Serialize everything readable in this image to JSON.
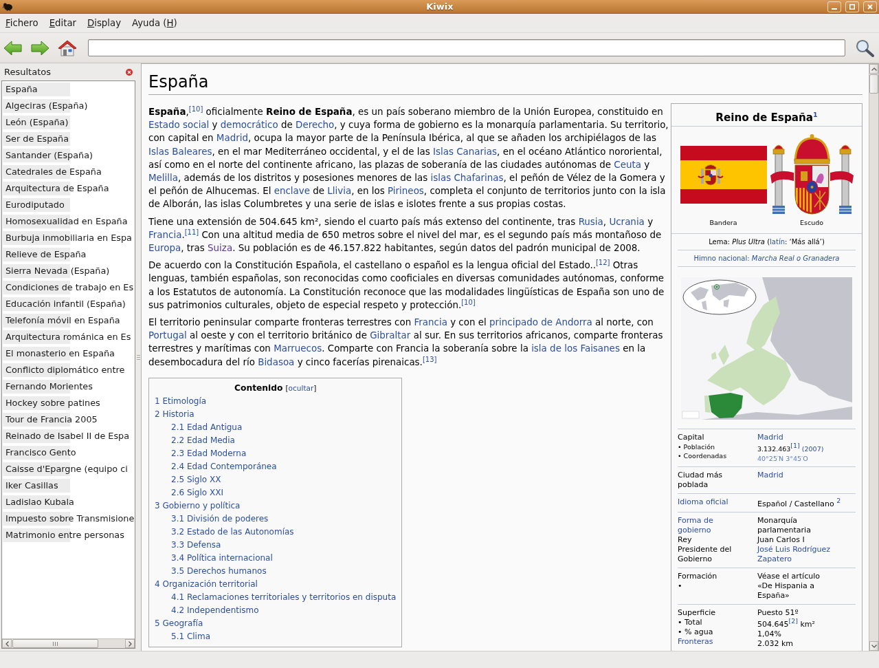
{
  "window": {
    "title": "Kiwix"
  },
  "menu": [
    {
      "key": "F",
      "after": "ichero"
    },
    {
      "key": "E",
      "after": "ditar"
    },
    {
      "key": "D",
      "after": "isplay"
    },
    {
      "before": "Ayuda (",
      "key": "H",
      "after": ")"
    }
  ],
  "sidebar": {
    "title": "Resultatos",
    "items": [
      "España",
      "Algeciras (España)",
      "León (España)",
      "Ser de España",
      "Santander (España)",
      "Catedrales de España",
      "Arquitectura de España",
      "Eurodiputado",
      "Homosexualidad en España",
      "Burbuja inmobiliaria en Espa",
      "Relieve de España",
      "Sierra Nevada (España)",
      "Condiciones de trabajo en Es",
      "Educación infantil (España)",
      "Telefonía móvil en España",
      "Arquitectura románica en Es",
      "El monasterio en España",
      "Conflicto diplomático entre",
      "Fernando Morientes",
      "Hockey sobre patines",
      "Tour de Francia 2005",
      "Reinado de Isabel II de Espa",
      "Francisco Gento",
      "Caisse d'Epargne (equipo ci",
      "Iker Casillas",
      "Ladislao Kubala",
      "Impuesto sobre Transmisione",
      "Matrimonio entre personas"
    ]
  },
  "article": {
    "title": "España",
    "paragraphs": [
      [
        {
          "kind": "text",
          "text": "**España**,"
        },
        {
          "kind": "ref",
          "text": "[10]"
        },
        {
          "kind": "text",
          "text": " oficialmente **Reino de España**, es un país soberano miembro de la Unión Europea, constituido en "
        },
        {
          "kind": "link",
          "text": "Estado social"
        },
        {
          "kind": "text",
          "text": " y "
        },
        {
          "kind": "link",
          "text": "democrático"
        },
        {
          "kind": "text",
          "text": " de "
        },
        {
          "kind": "link",
          "text": "Derecho"
        },
        {
          "kind": "text",
          "text": ", y cuya forma de gobierno es la monarquía parlamentaria. Su territorio, con capital en "
        },
        {
          "kind": "link",
          "text": "Madrid"
        },
        {
          "kind": "text",
          "text": ", ocupa la mayor parte de la Península Ibérica, al que se añaden los archipiélagos de las "
        },
        {
          "kind": "link",
          "text": "Islas"
        },
        {
          "kind": "link",
          "text": "Baleares"
        },
        {
          "kind": "text",
          "text": ", en el mar Mediterráneo occidental, y el de las "
        },
        {
          "kind": "link",
          "text": "Islas Canarias"
        },
        {
          "kind": "text",
          "text": ", en el océano Atlántico nororiental, así como en el norte del continente africano, las plazas de soberanía de las ciudades autónomas de "
        },
        {
          "kind": "link",
          "text": "Ceuta"
        },
        {
          "kind": "text",
          "text": " y "
        },
        {
          "kind": "link",
          "text": "Melilla"
        },
        {
          "kind": "text",
          "text": ", además de los distritos y posesiones menores de las "
        },
        {
          "kind": "link",
          "text": "islas Chafarinas"
        },
        {
          "kind": "text",
          "text": ", el peñón de Vélez de la Gomera y el peñón de Alhucemas. El "
        },
        {
          "kind": "link",
          "text": "enclave"
        },
        {
          "kind": "text",
          "text": " de "
        },
        {
          "kind": "link",
          "text": "Llivia"
        },
        {
          "kind": "text",
          "text": ", en los "
        },
        {
          "kind": "link",
          "text": "Pirineos"
        },
        {
          "kind": "text",
          "text": ", completa el conjunto de territorios junto con la isla de Alborán, las islas Columbretes y una serie de islas e islotes frente a sus propias costas."
        }
      ],
      [
        {
          "kind": "text",
          "text": "Tiene una extensión de 504.645 km², siendo el cuarto país más extenso del continente, tras "
        },
        {
          "kind": "link",
          "text": "Rusia"
        },
        {
          "kind": "text",
          "text": ", "
        },
        {
          "kind": "link",
          "text": "Ucrania"
        },
        {
          "kind": "text",
          "text": " y "
        },
        {
          "kind": "link",
          "text": "Francia"
        },
        {
          "kind": "text",
          "text": "."
        },
        {
          "kind": "ref",
          "text": "[11]"
        },
        {
          "kind": "text",
          "text": " Con una altitud media de 650 metros sobre el nivel del mar, es el segundo país más montañoso de "
        },
        {
          "kind": "link",
          "text": "Europa"
        },
        {
          "kind": "text",
          "text": ", tras "
        },
        {
          "kind": "visited",
          "text": "Suiza"
        },
        {
          "kind": "text",
          "text": ". Su población es de 46.157.822 habitantes, según datos del padrón municipal de 2008."
        }
      ],
      [
        {
          "kind": "text",
          "text": "De acuerdo con la Constitución Española, el castellano o español es la lengua oficial del Estado.."
        },
        {
          "kind": "ref",
          "text": "[12]"
        },
        {
          "kind": "text",
          "text": " Otras lenguas, también españolas, son reconocidas como cooficiales en diversas comunidades autónomas, conforme a los Estatutos de autonomía. La Constitución reconoce que las modalidades lingüísticas de España son uno de sus patrimonios culturales, objeto de especial respeto y protección."
        },
        {
          "kind": "ref",
          "text": "[10]"
        }
      ],
      [
        {
          "kind": "text",
          "text": "El territorio peninsular comparte fronteras terrestres con "
        },
        {
          "kind": "link",
          "text": "Francia"
        },
        {
          "kind": "text",
          "text": " y con el "
        },
        {
          "kind": "link",
          "text": "principado de Andorra"
        },
        {
          "kind": "text",
          "text": " al norte, con "
        },
        {
          "kind": "link",
          "text": "Portugal"
        },
        {
          "kind": "text",
          "text": " al oeste y con el territorio británico de "
        },
        {
          "kind": "link",
          "text": "Gibraltar"
        },
        {
          "kind": "text",
          "text": " al sur. En sus territorios africanos, comparte fronteras terrestres y marítimas con "
        },
        {
          "kind": "link",
          "text": "Marruecos"
        },
        {
          "kind": "text",
          "text": ". Comparte con Francia la soberanía sobre la "
        },
        {
          "kind": "link",
          "text": "isla de los Faisanes"
        },
        {
          "kind": "text",
          "text": " en la desembocadura del río "
        },
        {
          "kind": "link",
          "text": "Bidasoa"
        },
        {
          "kind": "text",
          "text": " y cinco facerías pirenaicas."
        },
        {
          "kind": "ref",
          "text": "[13]"
        }
      ]
    ],
    "toc": {
      "title": "Contenido",
      "toggle": {
        "before": "[",
        "link": "ocultar",
        "after": "]"
      },
      "items": [
        {
          "label": "1 Etimología"
        },
        {
          "label": "2 Historia",
          "children": [
            {
              "label": "2.1 Edad Antigua"
            },
            {
              "label": "2.2 Edad Media"
            },
            {
              "label": "2.3 Edad Moderna"
            },
            {
              "label": "2.4 Edad Contemporánea"
            },
            {
              "label": "2.5 Siglo XX"
            },
            {
              "label": "2.6 Siglo XXI"
            }
          ]
        },
        {
          "label": "3 Gobierno y política",
          "children": [
            {
              "label": "3.1 División de poderes"
            },
            {
              "label": "3.2 Estado de las Autonomías"
            },
            {
              "label": "3.3 Defensa"
            },
            {
              "label": "3.4 Política internacional"
            },
            {
              "label": "3.5 Derechos humanos"
            }
          ]
        },
        {
          "label": "4 Organización territorial",
          "children": [
            {
              "label": "4.1 Reclamaciones territoriales y territorios en disputa"
            },
            {
              "label": "4.2 Independentismo"
            }
          ]
        },
        {
          "label": "5 Geografía",
          "children": [
            {
              "label": "5.1 Clima"
            }
          ]
        }
      ]
    }
  },
  "infobox": {
    "title": "Reino de España",
    "title_ref": "1",
    "images": [
      {
        "kind": "flag",
        "caption": "Bandera"
      },
      {
        "kind": "coat_of_arms",
        "caption": "Escudo"
      }
    ],
    "motto": [
      {
        "kind": "text",
        "text": "Lema: *Plus Ultra* ("
      },
      {
        "kind": "link",
        "text": "latín"
      },
      {
        "kind": "text",
        "text": ": ‘Más allá’)"
      }
    ],
    "anthem": "Himno nacional: *Marcha Real o Granadera*",
    "rows": [
      {
        "labels": [
          [
            {
              "kind": "text",
              "text": "Capital"
            }
          ],
          [
            {
              "kind": "small",
              "text": "• Población"
            }
          ],
          [
            {
              "kind": "small",
              "text": "• Coordenadas"
            }
          ]
        ],
        "values": [
          [
            {
              "kind": "link",
              "text": "Madrid"
            }
          ],
          [
            {
              "kind": "small",
              "text": "3.132.463"
            },
            {
              "kind": "ref",
              "text": "[1]"
            },
            {
              "kind": "small_link",
              "text": "(2007)"
            }
          ],
          [
            {
              "kind": "coord",
              "text": "40°25′N 3°45′O"
            }
          ]
        ]
      },
      {
        "labels": [
          [
            {
              "kind": "text",
              "text": "Ciudad más poblada"
            }
          ]
        ],
        "values": [
          [
            {
              "kind": "link",
              "text": "Madrid"
            }
          ]
        ]
      },
      {
        "labels": [
          [
            {
              "kind": "link",
              "text": "Idioma oficial"
            }
          ]
        ],
        "values": [
          [
            {
              "kind": "text",
              "text": "Español / Castellano "
            },
            {
              "kind": "ref",
              "text": "2"
            }
          ]
        ]
      },
      {
        "labels": [
          [
            {
              "kind": "link",
              "text": "Forma de gobierno"
            }
          ],
          [
            {
              "kind": "text",
              "text": "Rey"
            }
          ],
          [
            {
              "kind": "text",
              "text": "Presidente del Gobierno"
            }
          ]
        ],
        "values": [
          [
            {
              "kind": "text",
              "text": "Monarquía parlamentaria"
            }
          ],
          [
            {
              "kind": "text",
              "text": "Juan Carlos I"
            }
          ],
          [
            {
              "kind": "link",
              "text": "José Luis Rodríguez Zapatero"
            }
          ]
        ]
      },
      {
        "labels": [
          [
            {
              "kind": "text",
              "text": "Formación"
            }
          ],
          [
            {
              "kind": "text",
              "text": "•"
            }
          ]
        ],
        "values": [
          [
            {
              "kind": "text",
              "text": "Véase el artículo «De Hispania a España»"
            }
          ]
        ]
      },
      {
        "labels": [
          [
            {
              "kind": "text",
              "text": "Superficie"
            }
          ],
          [
            {
              "kind": "text",
              "text": "• Total"
            }
          ],
          [
            {
              "kind": "text",
              "text": "• % agua"
            }
          ],
          [
            {
              "kind": "link",
              "text": "Fronteras"
            }
          ]
        ],
        "values": [
          [
            {
              "kind": "text",
              "text": "Puesto 51º"
            }
          ],
          [
            {
              "kind": "text",
              "text": "504.645"
            },
            {
              "kind": "ref",
              "text": "[2]"
            },
            {
              "kind": "text",
              "text": " km²"
            }
          ],
          [
            {
              "kind": "text",
              "text": "1,04%"
            }
          ],
          [
            {
              "kind": "text",
              "text": "2.032 km"
            }
          ]
        ]
      }
    ]
  }
}
